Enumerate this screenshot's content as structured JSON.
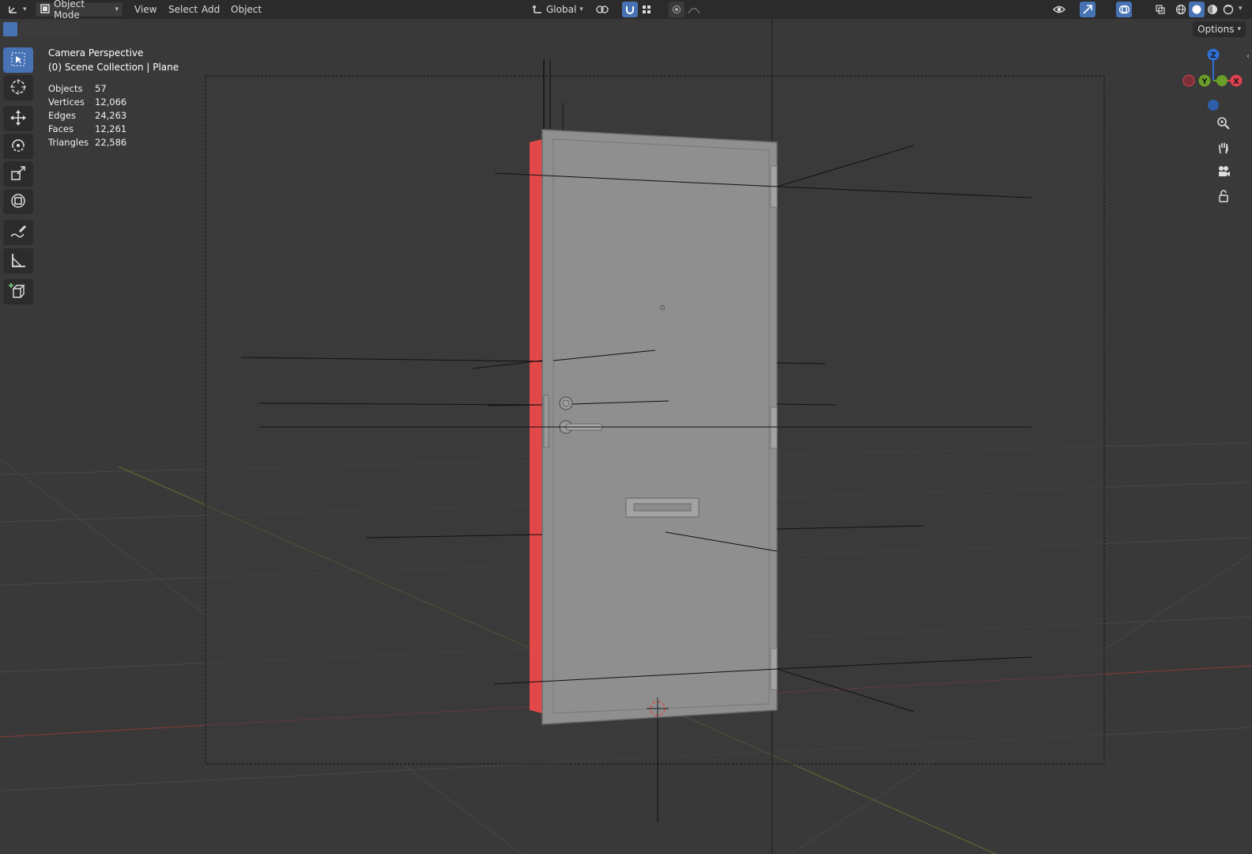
{
  "header": {
    "editor_type_icon": "axes-icon",
    "mode": "Object Mode",
    "menus": [
      "View",
      "Select",
      "Add",
      "Object"
    ],
    "transform_orientation": "Global",
    "options_label": "Options"
  },
  "viewport": {
    "perspective_label": "Camera Perspective",
    "collection_label": "(0) Scene Collection | Plane",
    "stats": [
      {
        "label": "Objects",
        "value": "57"
      },
      {
        "label": "Vertices",
        "value": "12,066"
      },
      {
        "label": "Edges",
        "value": "24,263"
      },
      {
        "label": "Faces",
        "value": "12,261"
      },
      {
        "label": "Triangles",
        "value": "22,586"
      }
    ]
  },
  "gizmo": {
    "axes": [
      "Z",
      "Y",
      "X"
    ],
    "colors": {
      "x": "#e0404f",
      "y": "#6a9f2a",
      "z": "#2f6ed3"
    }
  },
  "toolbar": {
    "tools": [
      "select-box-icon",
      "cursor-icon",
      "move-icon",
      "rotate-icon",
      "scale-icon",
      "transform-icon",
      "annotate-icon",
      "measure-icon",
      "add-cube-icon"
    ]
  },
  "colors": {
    "accent": "#4772b3",
    "background": "#303030",
    "door": "#8e8e8e",
    "door_side": "#e04848"
  }
}
